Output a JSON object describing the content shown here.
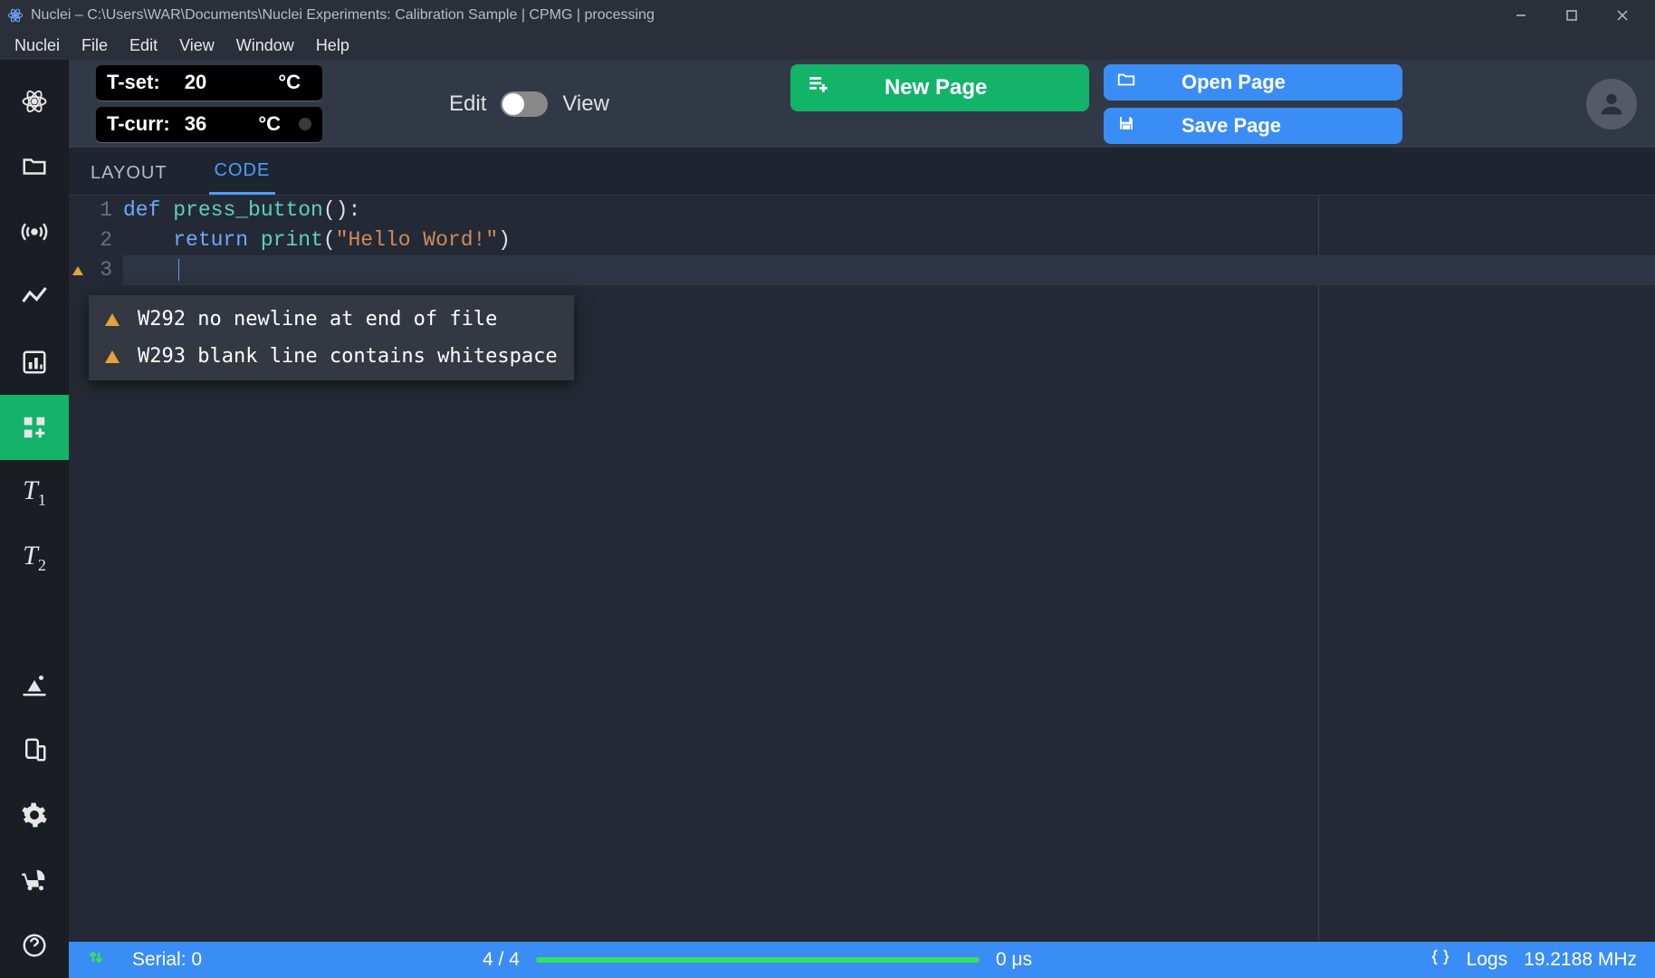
{
  "titlebar": {
    "title": "Nuclei – C:\\Users\\WAR\\Documents\\Nuclei Experiments: Calibration Sample | CPMG | processing"
  },
  "menubar": [
    "Nuclei",
    "File",
    "Edit",
    "View",
    "Window",
    "Help"
  ],
  "toolbar": {
    "t_set_label": "T-set:",
    "t_set_value": "20",
    "t_set_unit": "°C",
    "t_curr_label": "T-curr:",
    "t_curr_value": "36",
    "t_curr_unit": "°C",
    "edit_label": "Edit",
    "view_label": "View",
    "new_page": "New Page",
    "open_page": "Open Page",
    "save_page": "Save Page"
  },
  "sidebar_top": [
    {
      "name": "atom-icon"
    },
    {
      "name": "folder-icon"
    },
    {
      "name": "signal-icon"
    },
    {
      "name": "trend-icon"
    },
    {
      "name": "chart-icon"
    },
    {
      "name": "grid-plus-icon",
      "active": true
    },
    {
      "name": "t1-icon",
      "text": "T",
      "sub": "1"
    },
    {
      "name": "t2-icon",
      "text": "T",
      "sub": "2"
    }
  ],
  "sidebar_bottom": [
    {
      "name": "construction-icon"
    },
    {
      "name": "device-icon"
    },
    {
      "name": "gear-icon"
    },
    {
      "name": "stroller-icon"
    },
    {
      "name": "help-icon"
    }
  ],
  "tabs": {
    "layout": "LAYOUT",
    "code": "CODE"
  },
  "code": {
    "lines": [
      {
        "n": "1",
        "html": "<span class='tok-kw'>def</span> <span class='tok-fn'>press_button</span><span class='tok-op'>():</span>"
      },
      {
        "n": "2",
        "html": "    <span class='tok-kw'>return</span> <span class='tok-bi'>print</span><span class='tok-op'>(</span><span class='tok-str'>\"Hello Word!\"</span><span class='tok-op'>)</span>"
      },
      {
        "n": "3",
        "html": "    ",
        "warn": true
      }
    ]
  },
  "warnings": [
    "W292 no newline at end of file",
    "W293 blank line contains whitespace"
  ],
  "status": {
    "serial": "Serial: 0",
    "progress": "4 / 4",
    "time": "0 μs",
    "logs": "Logs",
    "freq": "19.2188 MHz"
  }
}
